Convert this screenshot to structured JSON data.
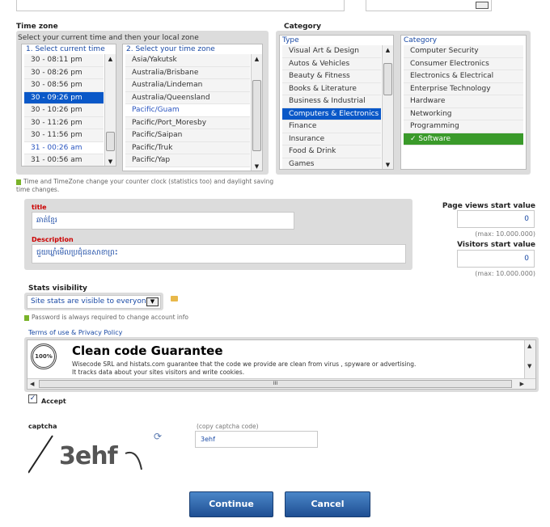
{
  "timezone": {
    "heading": "Time zone",
    "instruction": "Select your current time and then your local zone",
    "col1_header": "1. Select current time",
    "col2_header": "2. Select your time zone",
    "times": [
      "30 - 08:11 pm",
      "30 - 08:26 pm",
      "30 - 08:56 pm",
      "30 - 09:26 pm",
      "30 - 10:26 pm",
      "30 - 11:26 pm",
      "30 - 11:56 pm",
      "31 - 00:26 am",
      "31 - 00:56 am"
    ],
    "zones": [
      "Asia/Yakutsk",
      "Australia/Brisbane",
      "Australia/Lindeman",
      "Australia/Queensland",
      "Pacific/Guam",
      "Pacific/Port_Moresby",
      "Pacific/Saipan",
      "Pacific/Truk",
      "Pacific/Yap"
    ],
    "note": "Time and TimeZone change your counter clock (statistics too) and daylight saving time changes."
  },
  "category": {
    "heading": "Category",
    "type_header": "Type",
    "cat_header": "Category",
    "types": [
      "Visual Art & Design",
      "Autos & Vehicles",
      "Beauty & Fitness",
      "Books & Literature",
      "Business & Industrial",
      "Computers & Electronics",
      "Finance",
      "Insurance",
      "Food & Drink",
      "Games"
    ],
    "categories": [
      "Computer Security",
      "Consumer Electronics",
      "Electronics & Electrical",
      "Enterprise Technology",
      "Hardware",
      "Networking",
      "Programming",
      "✓ Software"
    ]
  },
  "form": {
    "title_label": "title",
    "title_value": "ឆាត់ខ្មែរ",
    "desc_label": "Description",
    "desc_value": "ជួយឃ្លាំមើលប្រជុំជនសាខាព្រះ",
    "pv_label": "Page views start value",
    "pv_value": "0",
    "pv_max": "(max: 10.000.000)",
    "vis_label": "Visitors start value",
    "vis_value": "0",
    "vis_max": "(max: 10.000.000)"
  },
  "stats": {
    "heading": "Stats visibility",
    "selected": "Site stats are visible to everyone.",
    "note": "Password is always required to change account info"
  },
  "terms": {
    "link": "Terms of use & Privacy Policy",
    "title": "Clean code Guarantee",
    "line1": "Wisecode SRL and histats.com guarantee that the code we provide are clean from virus , spyware or advertising.",
    "line2": "It tracks data about your sites visitors and write cookies.",
    "badge_text": "100%",
    "hscroll_grip": "III",
    "accept_label": "Accept"
  },
  "captcha": {
    "label": "captcha",
    "image_text": "3ehf",
    "hint": "(copy captcha code)",
    "value": "3ehf"
  },
  "buttons": {
    "continue": "Continue",
    "cancel": "Cancel"
  },
  "icons": {
    "up_arrow": "▲",
    "down_arrow": "▼",
    "left_arrow": "◀",
    "right_arrow": "▶",
    "refresh": "⟳"
  }
}
